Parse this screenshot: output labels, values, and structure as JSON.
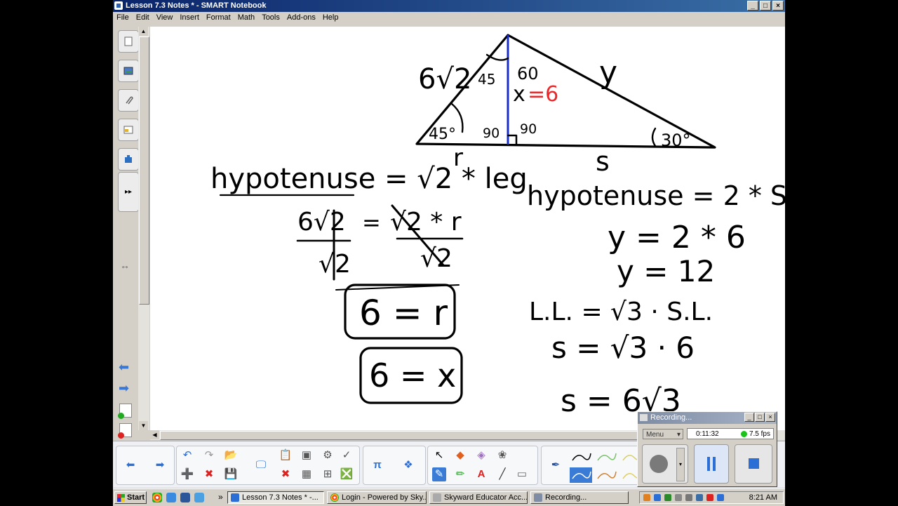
{
  "window": {
    "title": "Lesson 7.3 Notes * - SMART Notebook",
    "controls": [
      "_",
      "□",
      "×"
    ]
  },
  "menu": [
    "File",
    "Edit",
    "View",
    "Insert",
    "Format",
    "Math",
    "Tools",
    "Add-ons",
    "Help"
  ],
  "sidebar": {
    "tabs": [
      "page-sorter-icon",
      "gallery-icon",
      "attachments-icon",
      "properties-icon",
      "addons-icon"
    ],
    "expand": "▸▸",
    "resize": "↔"
  },
  "notes": {
    "triangle_labels": {
      "six_root_two": "6√2",
      "angle_45_top": "45",
      "angle_60": "60",
      "y_side": "y",
      "x_label": "x",
      "x_value": "=6",
      "angle_45_bottom": "45°",
      "angle_90_left": "90",
      "angle_90_right": "90",
      "angle_30": "30°",
      "r_side": "r",
      "s_side": "s"
    },
    "left_work": {
      "line1": "hypotenuse = √2 * leg",
      "line2_left_num": "6√2",
      "line2_eq": "=",
      "line2_right_num": "√2 * r",
      "line2_left_den": "√2",
      "line2_right_den": "√2",
      "box1": "6 = r",
      "box2": "6 = x"
    },
    "right_work": {
      "line1": "hypotenuse = 2 * S.L.",
      "line2": "y = 2 * 6",
      "line3": "y = 12",
      "line4": "L.L. = √3 · S.L.",
      "line5": "s = √3 · 6",
      "line6": "s = 6√3"
    },
    "colors": {
      "ink": "#000000",
      "red_ink": "#e8282a",
      "blue_line": "#1a2ec8"
    }
  },
  "toolbar": {
    "icons": [
      "back-icon",
      "forward-icon",
      "undo-icon",
      "redo-icon",
      "open-icon",
      "add-page-icon",
      "delete-page-icon",
      "save-icon",
      "screen-icon",
      "paste-icon",
      "delete-icon",
      "screen-shade-icon",
      "insert-table-icon",
      "document-camera-icon",
      "spelling-icon",
      "math-icon",
      "addon-icon",
      "select-icon",
      "fill-icon",
      "eraser-shape-icon",
      "magic-pen-icon",
      "pen-icon",
      "creative-pen-icon",
      "text-icon",
      "line-icon",
      "eraser-icon",
      "fountain-pen-icon"
    ],
    "text_tool": "A",
    "math_label": "π"
  },
  "recorder": {
    "title": "Recording...",
    "menu": "Menu",
    "time": "0:11:32",
    "fps": "7.5 fps",
    "controls": [
      "_",
      "□",
      "×"
    ]
  },
  "taskbar": {
    "start": "Start",
    "tasks": [
      {
        "label": "Lesson 7.3 Notes * -...",
        "active": true
      },
      {
        "label": "Login - Powered by Sky...",
        "active": false
      },
      {
        "label": "Skyward Educator Acc...",
        "active": false
      },
      {
        "label": "Recording...",
        "active": false
      }
    ],
    "more": "»",
    "clock": "8:21 AM"
  }
}
